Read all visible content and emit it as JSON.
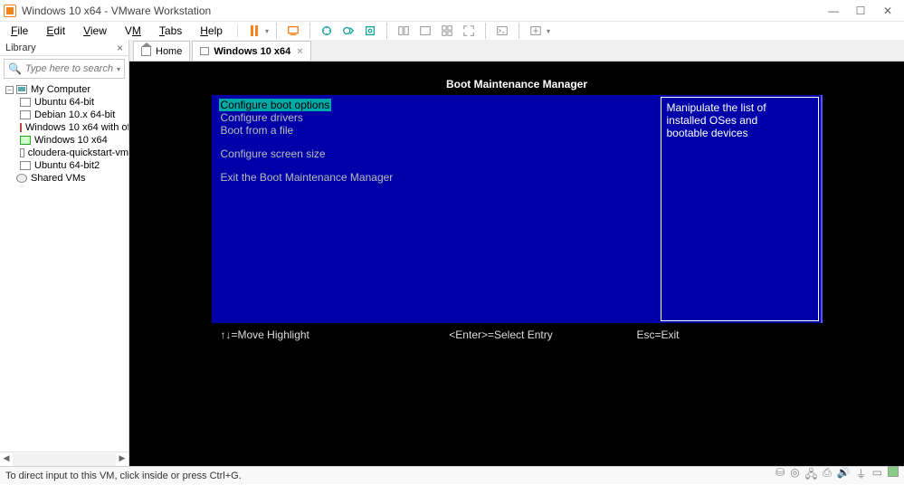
{
  "window": {
    "title": "Windows 10 x64 - VMware Workstation"
  },
  "menu": {
    "file": "File",
    "edit": "Edit",
    "view": "View",
    "vm": "VM",
    "tabs": "Tabs",
    "help": "Help"
  },
  "sidebar": {
    "header": "Library",
    "search_placeholder": "Type here to search",
    "root": "My Computer",
    "items": [
      "Ubuntu 64-bit",
      "Debian 10.x 64-bit",
      "Windows 10 x64 with of",
      "Windows 10 x64",
      "cloudera-quickstart-vm",
      "Ubuntu 64-bit2"
    ],
    "shared": "Shared VMs"
  },
  "tabs": {
    "home": "Home",
    "active": "Windows 10 x64"
  },
  "bios": {
    "title": "Boot Maintenance Manager",
    "opt_boot": "Configure boot options",
    "opt_drivers": "Configure drivers",
    "opt_file": "Boot from a file",
    "opt_screen": "Configure screen size",
    "opt_exit": "Exit the Boot Maintenance Manager",
    "help1": "Manipulate the list of",
    "help2": "installed OSes and",
    "help3": "bootable devices",
    "foot_move": "↑↓=Move Highlight",
    "foot_select": "<Enter>=Select Entry",
    "foot_esc": "Esc=Exit"
  },
  "footer": {
    "hint": "To direct input to this VM, click inside or press Ctrl+G."
  }
}
